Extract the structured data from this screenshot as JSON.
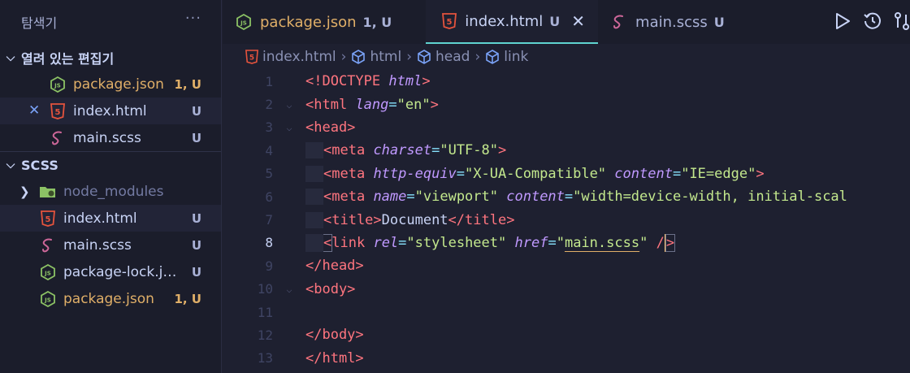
{
  "sidebar": {
    "title": "탐색기",
    "more": "···",
    "open_editors": {
      "title": "열려 있는 편집기",
      "items": [
        {
          "name": "package.json",
          "status": "1, U",
          "type": "node"
        },
        {
          "name": "index.html",
          "status": "U",
          "type": "html",
          "close": "✕"
        },
        {
          "name": "main.scss",
          "status": "U",
          "type": "sass"
        }
      ]
    },
    "folder": {
      "title": "SCSS",
      "items": [
        {
          "name": "node_modules",
          "status": "",
          "type": "folder"
        },
        {
          "name": "index.html",
          "status": "U",
          "type": "html"
        },
        {
          "name": "main.scss",
          "status": "U",
          "type": "sass"
        },
        {
          "name": "package-lock.json",
          "display": "package-lock.js...",
          "status": "U",
          "type": "node"
        },
        {
          "name": "package.json",
          "status": "1, U",
          "type": "node"
        }
      ]
    }
  },
  "tabs": [
    {
      "label": "package.json",
      "status": "1, U",
      "type": "node"
    },
    {
      "label": "index.html",
      "status": "U",
      "type": "html",
      "active": true,
      "close": "✕"
    },
    {
      "label": "main.scss",
      "status": "U",
      "type": "sass"
    }
  ],
  "breadcrumb": [
    "index.html",
    "html",
    "head",
    "link"
  ],
  "editor": {
    "current_line": 8,
    "line_numbers": [
      "1",
      "2",
      "3",
      "4",
      "5",
      "6",
      "7",
      "8",
      "9",
      "10",
      "11",
      "12",
      "13"
    ],
    "tokens": {
      "doctype": "<!DOCTYPE",
      "doctype_html": "html",
      "gt": ">",
      "lang_attr": "lang",
      "lang_val": "\"en\"",
      "charset_attr": "charset",
      "charset_val": "\"UTF-8\"",
      "httpequiv_attr": "http-equiv",
      "httpequiv_val": "\"X-UA-Compatible\"",
      "content_attr": "content",
      "content_val1": "\"IE=edge\"",
      "name_attr": "name",
      "name_val": "\"viewport\"",
      "content_val2": "\"width=device-width, initial-scal",
      "title_text": "Document",
      "rel_attr": "rel",
      "rel_val": "\"stylesheet\"",
      "href_attr": "href",
      "href_q": "\"",
      "href_file": "main.scss",
      "slash": "/"
    }
  },
  "colors": {
    "accent": "#5fd4d0",
    "html": "#e5533d",
    "node": "#8cc265",
    "sass": "#cd6799",
    "modified": "#e0af68"
  }
}
